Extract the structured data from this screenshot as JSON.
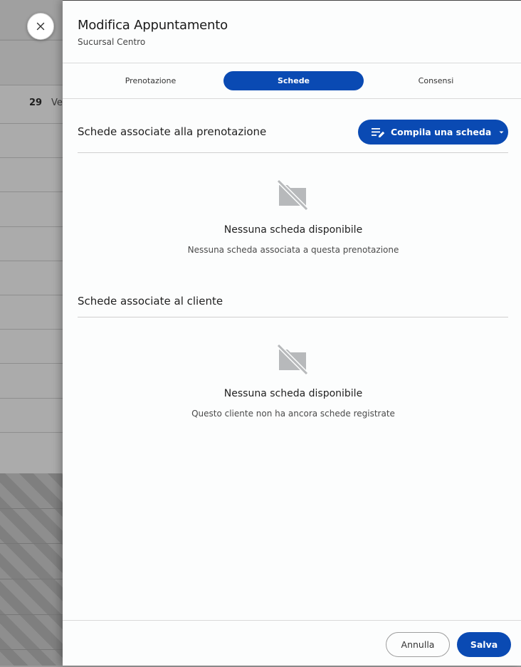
{
  "background": {
    "day_number": "29",
    "day_name": "Ve"
  },
  "colors": {
    "accent": "#0a4ab3",
    "panel_bg": "#fcfdfd",
    "icon_gray": "#b7b9bb"
  },
  "header": {
    "title": "Modifica Appuntamento",
    "subtitle": "Sucursal Centro",
    "close_icon": "close-icon"
  },
  "tabs": [
    {
      "label": "Prenotazione",
      "active": false
    },
    {
      "label": "Schede",
      "active": true
    },
    {
      "label": "Consensi",
      "active": false
    }
  ],
  "booking_section": {
    "title": "Schede associate alla prenotazione",
    "compile_button": {
      "label": "Compila una scheda",
      "icon": "edit-list-icon",
      "caret_icon": "caret-down-icon"
    },
    "empty": {
      "icon": "no-folder-icon",
      "title": "Nessuna scheda disponibile",
      "subtitle": "Nessuna scheda associata a questa prenotazione"
    }
  },
  "client_section": {
    "title": "Schede associate al cliente",
    "empty": {
      "icon": "no-folder-icon",
      "title": "Nessuna scheda disponibile",
      "subtitle": "Questo cliente non ha ancora schede registrate"
    }
  },
  "footer": {
    "cancel_label": "Annulla",
    "save_label": "Salva"
  }
}
